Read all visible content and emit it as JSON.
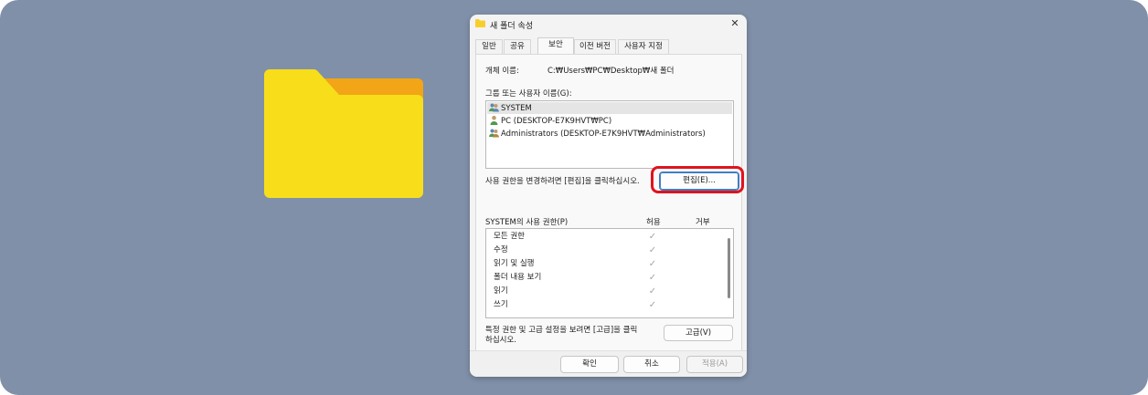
{
  "dialog": {
    "title": "새 폴더 속성",
    "close_label": "✕",
    "tabs": [
      {
        "label": "일반"
      },
      {
        "label": "공유"
      },
      {
        "label": "보안"
      },
      {
        "label": "이전 버전"
      },
      {
        "label": "사용자 지정"
      }
    ],
    "active_tab": "보안"
  },
  "security": {
    "object_name_label": "개체 이름:",
    "object_name_value": "C:₩Users₩PC₩Desktop₩새 폴더",
    "group_label": "그룹 또는 사용자 이름(G):",
    "users": [
      {
        "name": "SYSTEM",
        "icon": "group-user-icon"
      },
      {
        "name": "PC (DESKTOP-E7K9HVT₩PC)",
        "icon": "user-icon"
      },
      {
        "name": "Administrators (DESKTOP-E7K9HVT₩Administrators)",
        "icon": "group-user-icon"
      }
    ],
    "change_hint": "사용 권한을 변경하려면 [편집]을 클릭하십시오.",
    "edit_button": "편집(E)...",
    "permissions_label": "SYSTEM의 사용 권한(P)",
    "allow_header": "허용",
    "deny_header": "거부",
    "permissions": [
      {
        "name": "모든 권한",
        "allow": true,
        "deny": false
      },
      {
        "name": "수정",
        "allow": true,
        "deny": false
      },
      {
        "name": "읽기 및 실행",
        "allow": true,
        "deny": false
      },
      {
        "name": "폴더 내용 보기",
        "allow": true,
        "deny": false
      },
      {
        "name": "읽기",
        "allow": true,
        "deny": false
      },
      {
        "name": "쓰기",
        "allow": true,
        "deny": false
      }
    ],
    "check_glyph": "✓",
    "advanced_hint_line1": "특정 권한 및 고급 설정을 보려면 [고급]을 클릭",
    "advanced_hint_line2": "하십시오.",
    "advanced_button": "고급(V)"
  },
  "footer": {
    "ok_button": "확인",
    "cancel_button": "취소",
    "apply_button": "적용(A)"
  },
  "colors": {
    "background": "#8090a8",
    "folder_front": "#f8de1a",
    "folder_back": "#f2a516",
    "highlight": "#e0131e"
  }
}
